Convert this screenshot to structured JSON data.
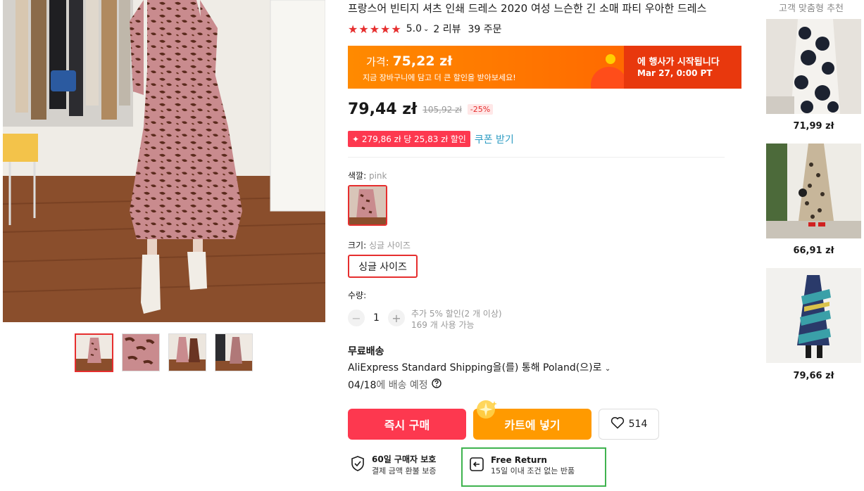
{
  "product": {
    "title": "프랑스어 빈티지 셔츠 인쇄 드레스 2020 여성 느슨한 긴 소매 파티 우아한 드레스",
    "rating": "5.0",
    "reviews": "2 리뷰",
    "orders": "39 주문"
  },
  "banner": {
    "price_label": "가격:",
    "price_value": "75,22 zł",
    "subtext": "지금 장바구니에 담고 더 큰 할인을 받아보세요!",
    "event_title": "에 행사가 시작됩니다",
    "event_time": "Mar 27, 0:00 PT"
  },
  "pricing": {
    "current": "79,44 zł",
    "original": "105,92 zł",
    "discount": "-25%",
    "coupon_badge": "✦ 279,86 zł 당 25,83 zł 할인",
    "coupon_link": "쿠폰 받기"
  },
  "options": {
    "color_label": "색깔:",
    "color_value": "pink",
    "size_label": "크기:",
    "size_value": "싱글 사이즈",
    "size_button": "싱글 사이즈",
    "qty_label": "수량:",
    "qty_value": "1",
    "qty_minus": "−",
    "qty_plus": "+",
    "qty_note1": "추가 5% 할인(2 개 이상)",
    "qty_note2": "169 개 사용 가능"
  },
  "shipping": {
    "title": "무료배송",
    "method": "AliExpress Standard Shipping을(를) 통해 Poland(으)로",
    "date": "04/18",
    "date_suffix": "에 배송 예정"
  },
  "actions": {
    "buy_now": "즉시 구매",
    "add_to_cart": "카트에 넣기",
    "wishlist_count": "514"
  },
  "protection": {
    "title": "60일 구매자 보호",
    "subtitle": "결제 금액 환불 보증",
    "return_title": "Free Return",
    "return_subtitle": "15일 이내 조건 없는 반품"
  },
  "recommendations": {
    "title": "고객 맞춤형 추천",
    "items": [
      {
        "price": "71,99 zł"
      },
      {
        "price": "66,91 zł"
      },
      {
        "price": "79,66 zł"
      }
    ]
  },
  "colors": {
    "accent_red": "#e62e2e",
    "banner_orange": "#ff7a00",
    "buy_red": "#fd384f",
    "cart_orange": "#ff9a00",
    "coupon_blue": "#2e9cc3",
    "highlight_green": "#3fb34f"
  }
}
